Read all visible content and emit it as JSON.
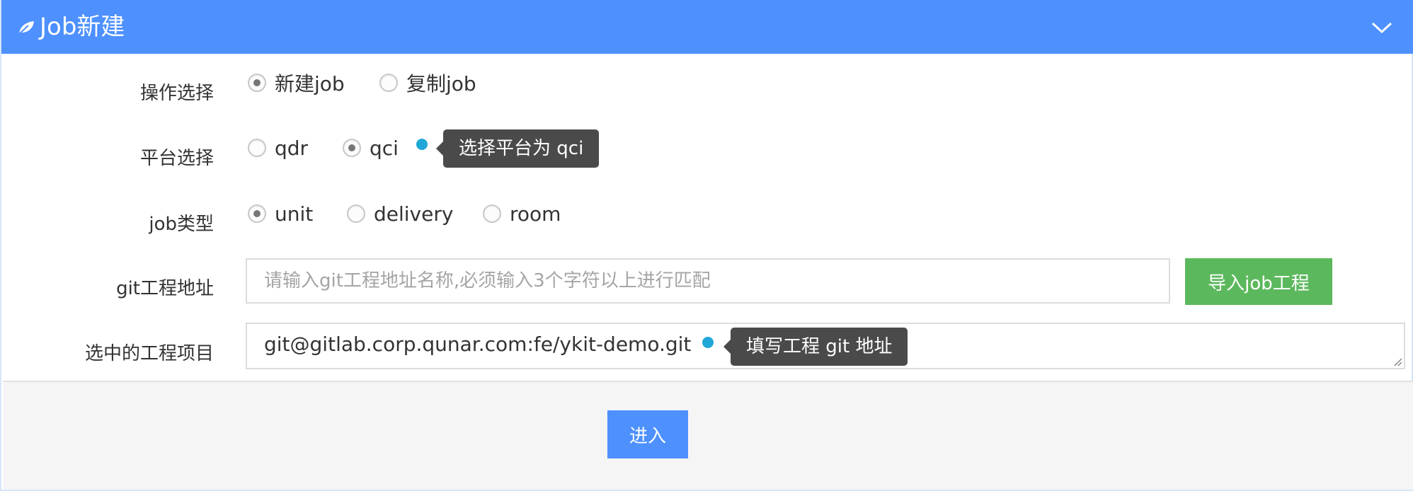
{
  "header": {
    "title": "Job新建",
    "icon": "leaf-icon",
    "collapse_icon": "chevron-down-icon",
    "bg_color": "#4d90fe"
  },
  "form": {
    "operation": {
      "label": "操作选择",
      "options": [
        {
          "label": "新建job",
          "checked": true
        },
        {
          "label": "复制job",
          "checked": false
        }
      ]
    },
    "platform": {
      "label": "平台选择",
      "options": [
        {
          "label": "qdr",
          "checked": false
        },
        {
          "label": "qci",
          "checked": true
        }
      ],
      "tooltip": "选择平台为 qci"
    },
    "job_type": {
      "label": "job类型",
      "options": [
        {
          "label": "unit",
          "checked": true
        },
        {
          "label": "delivery",
          "checked": false
        },
        {
          "label": "room",
          "checked": false
        }
      ]
    },
    "git_address": {
      "label": "git工程地址",
      "value": "",
      "placeholder": "请输入git工程地址名称,必须输入3个字符以上进行匹配",
      "import_button": "导入job工程",
      "import_color": "#5cb85c"
    },
    "selected_project": {
      "label": "选中的工程项目",
      "value": "git@gitlab.corp.qunar.com:fe/ykit-demo.git",
      "tooltip": "填写工程 git 地址"
    }
  },
  "footer": {
    "enter_button": "进入"
  }
}
